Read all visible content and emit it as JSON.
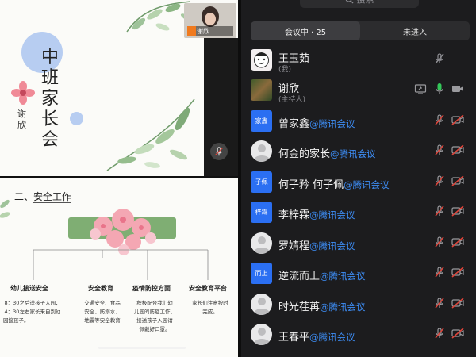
{
  "slide1": {
    "title": "中班家长会",
    "author": "谢欣",
    "tile_name": "谢欣"
  },
  "slide2": {
    "section_title_prefix": "二、",
    "section_title": "安全工作",
    "columns": [
      {
        "heading": "幼儿接送安全",
        "lines": [
          "8：30之后送孩子入园，",
          "4：30左右家长来自到幼",
          "园接孩子。"
        ]
      },
      {
        "heading": "安全教育",
        "lines": [
          "交通安全、食品",
          "安全、防溺水、",
          "地震等安全教育"
        ]
      },
      {
        "heading": "疫情防控方面",
        "lines": [
          "积极配合我们幼",
          "儿园的防疫工作，",
          "接送孩子入园请",
          "佩戴好口罩。"
        ]
      },
      {
        "heading": "安全教育平台",
        "lines": [
          "家长们注意按时",
          "完成。"
        ]
      }
    ]
  },
  "search": {
    "placeholder": "搜索"
  },
  "tabs": [
    {
      "label": "会议中 · 25",
      "active": true
    },
    {
      "label": "未进入",
      "active": false
    }
  ],
  "participants": [
    {
      "name": "王玉茹",
      "subtitle": "(我)",
      "suffix": "",
      "avatar_type": "cartoon",
      "avatar_text": "",
      "mic": "muted-gray",
      "video": "none",
      "screen": false
    },
    {
      "name": "谢欣",
      "subtitle": "(主持人)",
      "suffix": "",
      "avatar_type": "photo",
      "avatar_text": "",
      "mic": "active-green",
      "video": "on",
      "screen": true
    },
    {
      "name": "曾家鑫",
      "subtitle": "",
      "suffix": "@腾讯会议",
      "avatar_type": "blue",
      "avatar_text": "家鑫",
      "mic": "muted-red",
      "video": "off-red",
      "screen": false
    },
    {
      "name": "何金的家长",
      "subtitle": "",
      "suffix": "@腾讯会议",
      "avatar_type": "gray",
      "avatar_text": "",
      "mic": "muted-red",
      "video": "off-red",
      "screen": false
    },
    {
      "name": "何子矜 何子佩",
      "subtitle": "",
      "suffix": "@腾讯会议",
      "avatar_type": "blue",
      "avatar_text": "子佩",
      "mic": "muted-red",
      "video": "off-red",
      "screen": false
    },
    {
      "name": "李梓霖",
      "subtitle": "",
      "suffix": "@腾讯会议",
      "avatar_type": "blue",
      "avatar_text": "梓霖",
      "mic": "muted-red",
      "video": "off-red",
      "screen": false
    },
    {
      "name": "罗婧程",
      "subtitle": "",
      "suffix": "@腾讯会议",
      "avatar_type": "gray",
      "avatar_text": "",
      "mic": "muted-red",
      "video": "off-red",
      "screen": false
    },
    {
      "name": "逆流而上",
      "subtitle": "",
      "suffix": "@腾讯会议",
      "avatar_type": "blue",
      "avatar_text": "而上",
      "mic": "muted-red",
      "video": "off-red",
      "screen": false
    },
    {
      "name": "时光荏苒",
      "subtitle": "",
      "suffix": "@腾讯会议",
      "avatar_type": "gray",
      "avatar_text": "",
      "mic": "muted-red",
      "video": "off-red",
      "screen": false
    },
    {
      "name": "王春平",
      "subtitle": "",
      "suffix": "@腾讯会议",
      "avatar_type": "gray",
      "avatar_text": "",
      "mic": "muted-red",
      "video": "off-red",
      "screen": false
    }
  ],
  "colors": {
    "accent_blue": "#3d8df5",
    "avatar_blue": "#2b6ff2",
    "muted_red": "#e0443a",
    "mic_green": "#34c759",
    "banner_green": "#7fae73",
    "circle_blue": "#b7cdf1",
    "badge_orange": "#f07a1e"
  },
  "icons": [
    "search-icon",
    "mic-muted-icon",
    "mic-icon",
    "video-off-icon",
    "video-icon",
    "screen-share-icon",
    "flower-icon",
    "leaf-decoration-icon"
  ]
}
